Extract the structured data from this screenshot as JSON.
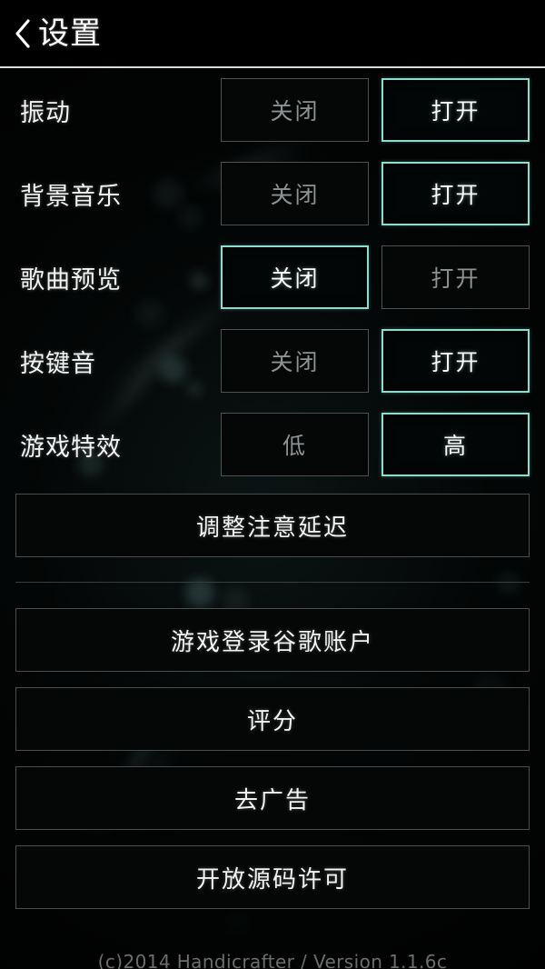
{
  "header": {
    "title": "设置",
    "back_icon": "chevron-left-icon"
  },
  "settings": [
    {
      "label": "振动",
      "options": [
        {
          "label": "关闭",
          "selected": false
        },
        {
          "label": "打开",
          "selected": true
        }
      ]
    },
    {
      "label": "背景音乐",
      "options": [
        {
          "label": "关闭",
          "selected": false
        },
        {
          "label": "打开",
          "selected": true
        }
      ]
    },
    {
      "label": "歌曲预览",
      "options": [
        {
          "label": "关闭",
          "selected": true
        },
        {
          "label": "打开",
          "selected": false
        }
      ]
    },
    {
      "label": "按键音",
      "options": [
        {
          "label": "关闭",
          "selected": false
        },
        {
          "label": "打开",
          "selected": true
        }
      ]
    },
    {
      "label": "游戏特效",
      "options": [
        {
          "label": "低",
          "selected": false
        },
        {
          "label": "高",
          "selected": true
        }
      ]
    }
  ],
  "actions": {
    "calibrate": "调整注意延迟",
    "google_login": "游戏登录谷歌账户",
    "rate": "评分",
    "remove_ads": "去广告",
    "licenses": "开放源码许可"
  },
  "footer": {
    "text": "(c)2014 Handicrafter / Version 1.1.6c"
  },
  "colors": {
    "accent": "#8ddcd0",
    "background": "#030505",
    "text": "#f2f4f4",
    "muted_text": "#8d9292",
    "border": "#4e5252"
  }
}
